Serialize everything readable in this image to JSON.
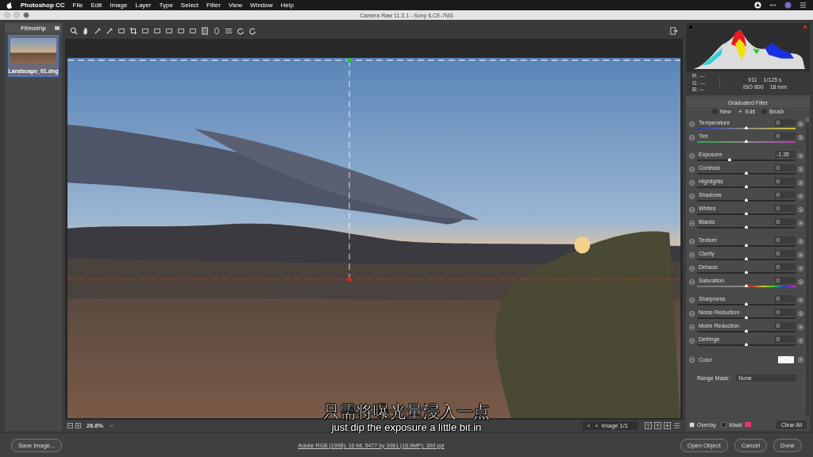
{
  "menu_bar": {
    "app": "Photoshop CC",
    "items": [
      "File",
      "Edit",
      "Image",
      "Layer",
      "Type",
      "Select",
      "Filter",
      "View",
      "Window",
      "Help"
    ]
  },
  "window": {
    "title": "Camera Raw 11.3.1  -  Sony ILCE-7M3"
  },
  "filmstrip": {
    "title": "Filmstrip",
    "items": [
      {
        "filename": "Landscape_01.dng",
        "selected": true
      }
    ]
  },
  "status": {
    "zoom": "26.6%",
    "image_nav": "Image 1/1"
  },
  "histogram": {
    "r": "R:",
    "g": "G:",
    "b": "B:",
    "r_value": "---",
    "g_value": "---",
    "b_value": "---",
    "aperture": "f/11",
    "shutter": "1/125 s",
    "iso": "ISO 800",
    "focal": "18 mm"
  },
  "panel": {
    "title": "Graduated Filter",
    "modes": [
      {
        "label": "New",
        "selected": false
      },
      {
        "label": "Edit",
        "selected": true
      },
      {
        "label": "Brush",
        "selected": false
      }
    ],
    "groups": [
      [
        {
          "label": "Temperature",
          "value": "0",
          "level": 0.5,
          "kind": "temperature"
        },
        {
          "label": "Tint",
          "value": "0",
          "level": 0.5,
          "kind": "tint"
        }
      ],
      [
        {
          "label": "Exposure",
          "value": "-1.35",
          "level": 0.33,
          "kind": "plain"
        },
        {
          "label": "Contrast",
          "value": "0",
          "level": 0.5,
          "kind": "plain"
        },
        {
          "label": "Highlights",
          "value": "0",
          "level": 0.5,
          "kind": "plain"
        },
        {
          "label": "Shadows",
          "value": "0",
          "level": 0.5,
          "kind": "plain"
        },
        {
          "label": "Whites",
          "value": "0",
          "level": 0.5,
          "kind": "plain"
        },
        {
          "label": "Blacks",
          "value": "0",
          "level": 0.5,
          "kind": "plain"
        }
      ],
      [
        {
          "label": "Texture",
          "value": "0",
          "level": 0.5,
          "kind": "plain"
        },
        {
          "label": "Clarity",
          "value": "0",
          "level": 0.5,
          "kind": "plain"
        },
        {
          "label": "Dehaze",
          "value": "0",
          "level": 0.5,
          "kind": "plain"
        },
        {
          "label": "Saturation",
          "value": "0",
          "level": 0.5,
          "kind": "saturation"
        }
      ],
      [
        {
          "label": "Sharpness",
          "value": "0",
          "level": 0.5,
          "kind": "plain"
        },
        {
          "label": "Noise Reduction",
          "value": "0",
          "level": 0.5,
          "kind": "plain"
        },
        {
          "label": "Moire Reduction",
          "value": "0",
          "level": 0.5,
          "kind": "plain"
        },
        {
          "label": "Defringe",
          "value": "0",
          "level": 0.5,
          "kind": "plain"
        }
      ]
    ],
    "color_label": "Color",
    "range_mask_label": "Range Mask:",
    "range_mask_value": "None",
    "overlay": {
      "label": "Overlay",
      "checked": true
    },
    "mask": {
      "label": "Mask",
      "checked": false,
      "color": "#e8336a"
    },
    "clear_all": "Clear All"
  },
  "bottom": {
    "save": "Save Image...",
    "workflow": "Adobe RGB (1998); 16 bit; 5477 by 3081 (16.9MP); 300 ppi",
    "buttons": [
      "Open Object",
      "Cancel",
      "Done"
    ]
  },
  "subtitle": {
    "zh": "只需将曝光量浸入一点",
    "en": "just dip the exposure a little bit in"
  }
}
